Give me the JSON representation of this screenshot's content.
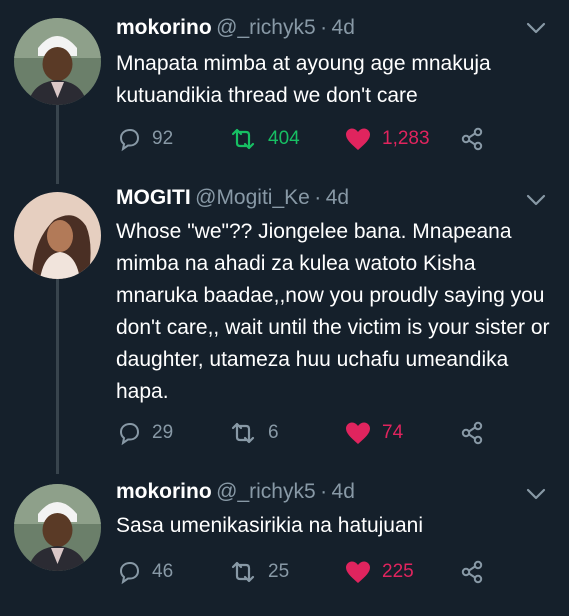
{
  "tweets": [
    {
      "display_name": "mokorino",
      "handle": "@_richyk5",
      "separator": "·",
      "time": "4d",
      "text": "Mnapata mimba at ayoung age mnakuja kutuandikia thread we don't care",
      "replies": "92",
      "retweets": "404",
      "likes": "1,283",
      "retweeted": true,
      "liked": true,
      "avatar": "avatar-man-white-cap"
    },
    {
      "display_name": "MOGITI",
      "handle": "@Mogiti_Ke",
      "separator": "·",
      "time": "4d",
      "text": "Whose \"we\"?? Jiongelee bana. Mnapeana mimba na ahadi za kulea watoto Kisha mnaruka baadae,,now you proudly saying you don't care,, wait until the victim is your sister or daughter, utameza huu uchafu umeandika hapa.",
      "replies": "29",
      "retweets": "6",
      "likes": "74",
      "retweeted": false,
      "liked": true,
      "avatar": "avatar-woman"
    },
    {
      "display_name": "mokorino",
      "handle": "@_richyk5",
      "separator": "·",
      "time": "4d",
      "text": "Sasa umenikasirikia na hatujuani",
      "replies": "46",
      "retweets": "25",
      "likes": "225",
      "retweeted": false,
      "liked": true,
      "avatar": "avatar-man-white-cap"
    }
  ],
  "colors": {
    "background": "#15202b",
    "text": "#ffffff",
    "secondary": "#8899a6",
    "retweet_active": "#17bf63",
    "like_active": "#e0245e",
    "thread_line": "#38444d"
  }
}
